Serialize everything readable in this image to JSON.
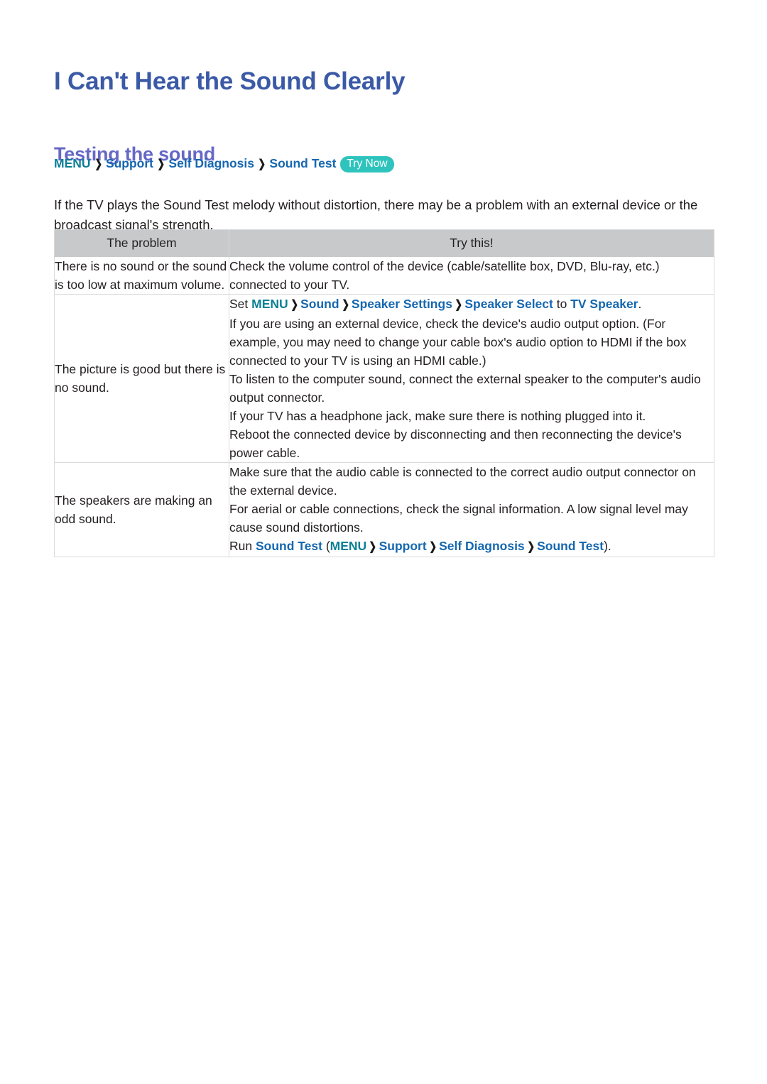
{
  "document": {
    "title": "I Can't Hear the Sound Clearly",
    "section_heading": "Testing the sound"
  },
  "breadcrumb": {
    "menu": "MENU",
    "separator": "❯",
    "items": [
      "Support",
      "Self Diagnosis",
      "Sound Test"
    ],
    "badge": "Try Now"
  },
  "intro": {
    "text": "If the TV plays the Sound Test melody without distortion, there may be a problem with an external device or the broadcast signal's strength."
  },
  "table": {
    "headers": {
      "problem": "The problem",
      "try_this": "Try this!"
    },
    "rows": [
      {
        "problem": "There is no sound or the sound is too low at maximum volume.",
        "lines": [
          "Check the volume control of the device (cable/satellite box, DVD, Blu-ray, etc.) connected to your TV."
        ]
      },
      {
        "problem": "The picture is good but there is no sound.",
        "lines": [
          "Set MENU ❯ Sound ❯ Speaker Settings ❯ Speaker Select to TV Speaker.",
          "If you are using an external device, check the device's audio output option. (For example, you may need to change your cable box's audio option to HDMI if the box connected to your TV is using an HDMI cable.)",
          "To listen to the computer sound, connect the external speaker to the computer's audio output connector.",
          "If your TV has a headphone jack, make sure there is nothing plugged into it.",
          "Reboot the connected device by disconnecting and then reconnecting the device's power cable."
        ],
        "menu_path_line": {
          "prefix": "Set ",
          "menu": "MENU",
          "items": [
            "Sound",
            "Speaker Settings",
            "Speaker Select"
          ],
          "middle": " to ",
          "target": "TV Speaker",
          "suffix": "."
        }
      },
      {
        "problem": "The speakers are making an odd sound.",
        "lines": [
          "Make sure that the audio cable is connected to the correct audio output connector on the external device.",
          "For aerial or cable connections, check the signal information. A low signal level may cause sound distortions.",
          "Run Sound Test (MENU ❯ Support ❯ Self Diagnosis ❯ Sound Test)."
        ],
        "run_line": {
          "prefix": "Run ",
          "link": "Sound Test",
          "open_paren": " (",
          "menu": "MENU",
          "items": [
            "Support",
            "Self Diagnosis",
            "Sound Test"
          ],
          "close_paren": ")."
        }
      }
    ]
  },
  "colors": {
    "title": "#3b5aa6",
    "section_heading": "#6668c6",
    "menu_teal": "#0b7f96",
    "link_blue": "#1567b0",
    "badge_bg": "#2ec4bd",
    "table_header_bg": "#c8c9ca",
    "table_border": "#d9dadb"
  }
}
